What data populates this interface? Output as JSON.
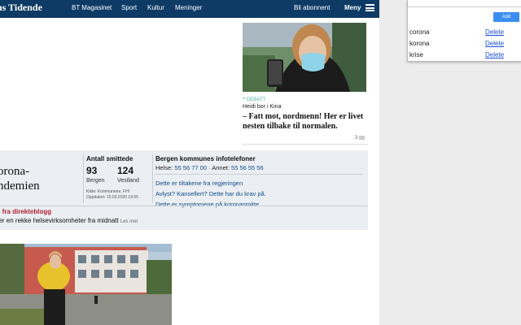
{
  "header": {
    "logo_text": "ns Tidende",
    "nav": [
      "BT Magasinet",
      "Sport",
      "Kultur",
      "Meninger"
    ],
    "subscribe_label": "Bli abonnent",
    "menu_label": "Meny"
  },
  "article_card": {
    "tag": "DEBATT",
    "byline": "Heidi bor i Kina",
    "headline": "– Fatt mot, nordmenn! Her er livet nesten tilbake til normalen.",
    "comment_count": "3"
  },
  "corona_box": {
    "title_line1": "orona-",
    "title_line2": "ndemien",
    "infections": {
      "title": "Antall smittede",
      "bergen_value": "93",
      "bergen_label": "Bergen",
      "vestland_value": "124",
      "vestland_label": "Vestland",
      "source_line1": "Kilde: Kommunene, FHI",
      "source_line2": "Oppdatert: 15.03.2020 19:55"
    },
    "phones": {
      "title": "Bergen kommunes infotelefoner",
      "line_prefix_helse": "Helse:",
      "helse_number": "55 56 77 00",
      "line_prefix_annet": "· Annet:",
      "annet_number": "55 56 55 56",
      "links": [
        "Dette er tiltakene fra regjeringen",
        "Avlyst? Kansellert? Dette har du krav på.",
        "Dette er symptomene på koronasmitte"
      ]
    },
    "blog_label": "e fra direkteblogg",
    "blog_text": "ger en rekke helsevirksomheter fra midnatt",
    "blog_more": "Les mer"
  },
  "popup": {
    "input_value": "",
    "add_label": "Add",
    "keywords": [
      {
        "word": "corona",
        "action": "Delete"
      },
      {
        "word": "korona",
        "action": "Delete"
      },
      {
        "word": "krise",
        "action": "Delete"
      }
    ]
  },
  "colors": {
    "header_bg": "#0d3b66",
    "link": "#0d4d8b",
    "blog_label": "#b02030",
    "add_button": "#3b8df2"
  }
}
